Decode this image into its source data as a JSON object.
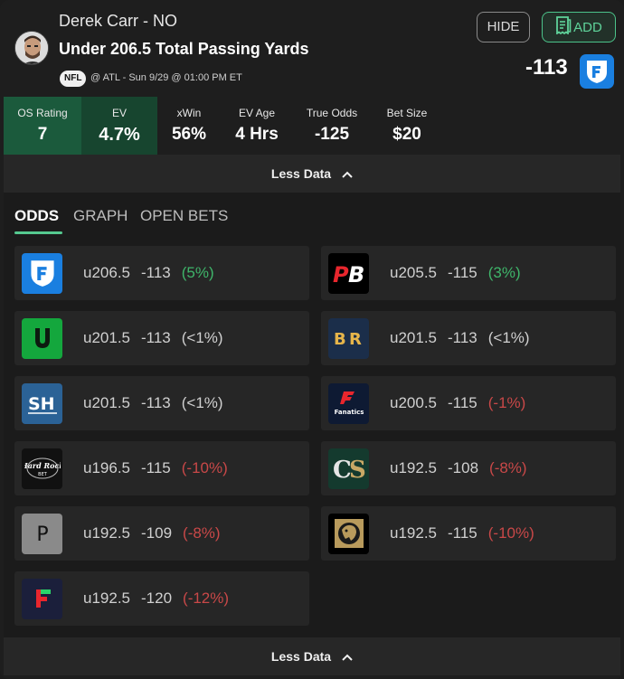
{
  "header": {
    "player": "Derek Carr - NO",
    "market": "Under 206.5 Total Passing Yards",
    "league": "NFL",
    "game_info": "@ ATL - Sun 9/29 @ 01:00 PM ET",
    "hide_label": "HIDE",
    "add_label": "ADD",
    "odds": "-113",
    "book_icon": "fanduel-icon"
  },
  "stats": [
    {
      "label": "OS Rating",
      "value": "7"
    },
    {
      "label": "EV",
      "value": "4.7%"
    },
    {
      "label": "xWin",
      "value": "56%"
    },
    {
      "label": "EV Age",
      "value": "4 Hrs"
    },
    {
      "label": "True Odds",
      "value": "-125"
    },
    {
      "label": "Bet Size",
      "value": "$20"
    }
  ],
  "less_data_label": "Less Data",
  "tabs": [
    {
      "label": "ODDS",
      "active": true
    },
    {
      "label": "GRAPH",
      "active": false
    },
    {
      "label": "OPEN BETS",
      "active": false
    }
  ],
  "odds_rows": [
    {
      "book": "FanDuel",
      "icon": "fanduel-icon",
      "line": "u206.5",
      "price": "-113",
      "pct": "(5%)",
      "sentiment": "pos",
      "color": "#1a7fe0"
    },
    {
      "book": "PointsBet",
      "icon": "pointsbet-icon",
      "line": "u205.5",
      "price": "-115",
      "pct": "(3%)",
      "sentiment": "pos",
      "color": "#000000"
    },
    {
      "book": "Unibet",
      "icon": "unibet-icon",
      "line": "u201.5",
      "price": "-113",
      "pct": "(<1%)",
      "sentiment": "neu",
      "color": "#14a73d"
    },
    {
      "book": "BetRivers",
      "icon": "betrivers-icon",
      "line": "u201.5",
      "price": "-113",
      "pct": "(<1%)",
      "sentiment": "neu",
      "color": "#1b2e4a"
    },
    {
      "book": "SuperBook",
      "icon": "superbook-icon",
      "line": "u201.5",
      "price": "-113",
      "pct": "(<1%)",
      "sentiment": "neu",
      "color": "#2b6296"
    },
    {
      "book": "Fanatics",
      "icon": "fanatics-icon",
      "line": "u200.5",
      "price": "-115",
      "pct": "(-1%)",
      "sentiment": "neg",
      "color": "#0e1a33"
    },
    {
      "book": "Hard Rock Bet",
      "icon": "hardrock-icon",
      "line": "u196.5",
      "price": "-115",
      "pct": "(-10%)",
      "sentiment": "neg",
      "color": "#111111"
    },
    {
      "book": "Caesars",
      "icon": "caesars-icon",
      "line": "u192.5",
      "price": "-108",
      "pct": "(-8%)",
      "sentiment": "neg",
      "color": "#143a2e"
    },
    {
      "book": "Pinnacle",
      "icon": "pinnacle-icon",
      "line": "u192.5",
      "price": "-109",
      "pct": "(-8%)",
      "sentiment": "neg",
      "color": "#8a8a8a"
    },
    {
      "book": "BetMGM",
      "icon": "betmgm-icon",
      "line": "u192.5",
      "price": "-115",
      "pct": "(-10%)",
      "sentiment": "neg",
      "color": "#b89a5c"
    },
    {
      "book": "Fliff",
      "icon": "fliff-icon",
      "line": "u192.5",
      "price": "-120",
      "pct": "(-12%)",
      "sentiment": "neg",
      "color": "#1b1f3b"
    }
  ]
}
